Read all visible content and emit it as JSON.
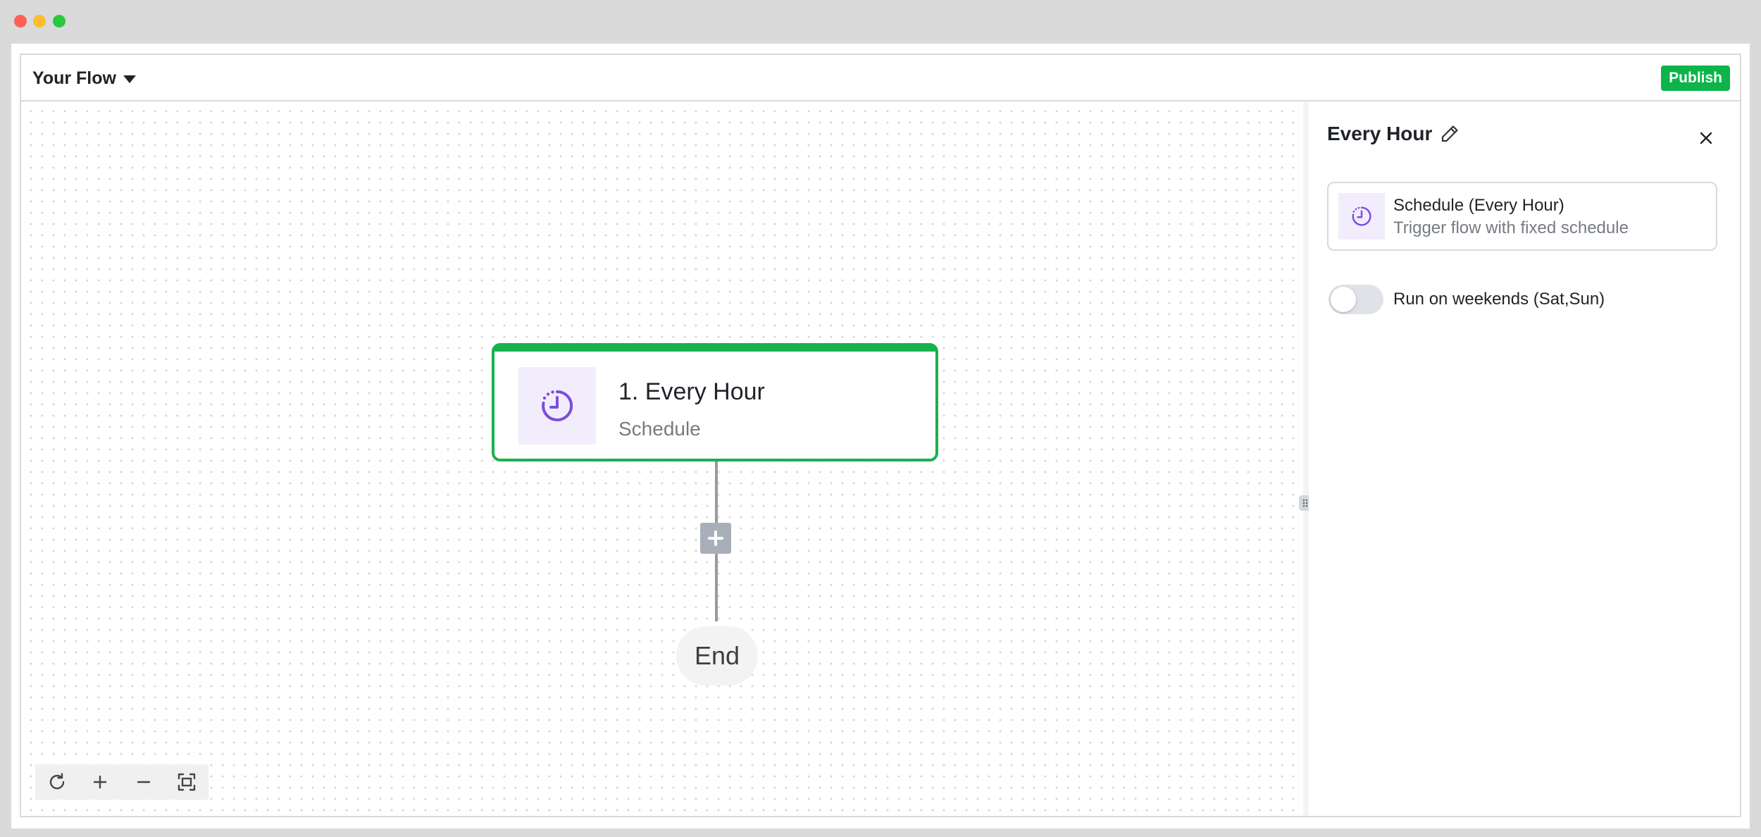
{
  "header": {
    "flow_title": "Your Flow",
    "publish_label": "Publish"
  },
  "canvas": {
    "trigger_node": {
      "title": "1. Every Hour",
      "subtitle": "Schedule",
      "icon": "schedule-clock-icon"
    },
    "add_step_icon": "plus-icon",
    "end_label": "End",
    "zoom_controls": [
      "refresh-icon",
      "zoom-in-icon",
      "zoom-out-icon",
      "fit-view-icon"
    ]
  },
  "panel": {
    "title": "Every Hour",
    "edit_icon": "pencil-icon",
    "close_icon": "close-icon",
    "trigger": {
      "name": "Schedule (Every Hour)",
      "description": "Trigger flow with fixed schedule"
    },
    "weekend_toggle": {
      "label": "Run on weekends (Sat,Sun)",
      "checked": false
    }
  },
  "colors": {
    "accent_green": "#0cb44a",
    "node_border": "#16b24c",
    "icon_purple": "#7c4dde",
    "icon_bg": "#f2edfd"
  }
}
